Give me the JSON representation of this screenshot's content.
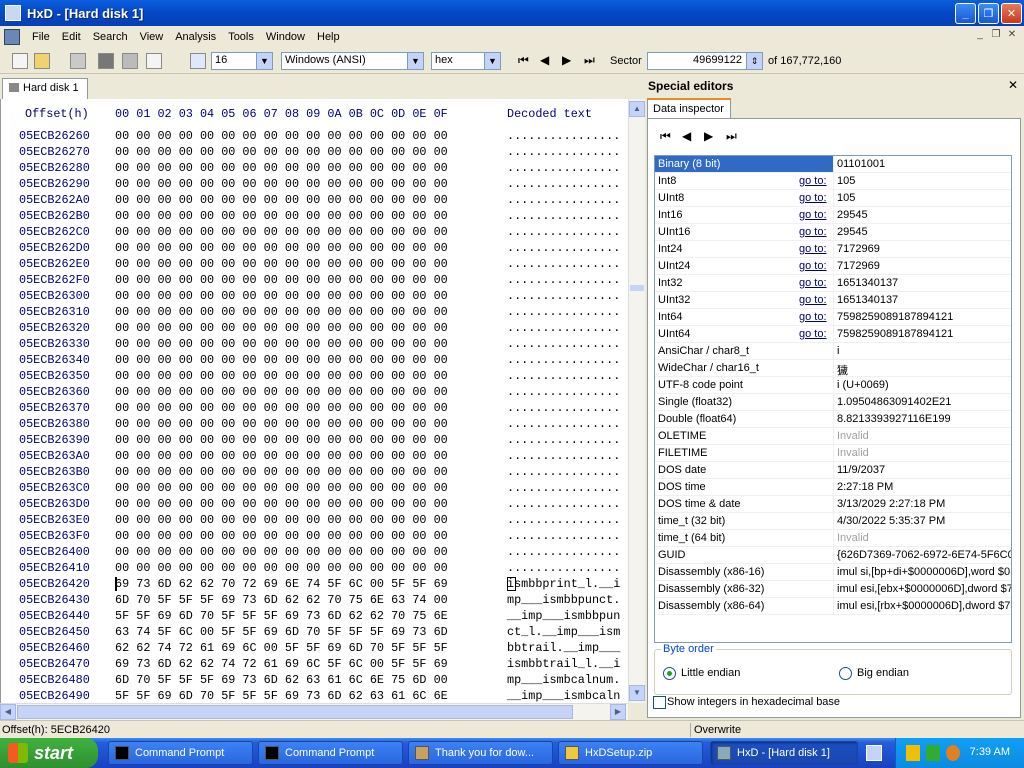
{
  "window": {
    "title": "HxD - [Hard disk 1]"
  },
  "menu": [
    "File",
    "Edit",
    "Search",
    "View",
    "Analysis",
    "Tools",
    "Window",
    "Help"
  ],
  "toolbar": {
    "bytes_per_row": "16",
    "charset": "Windows (ANSI)",
    "offset_base": "hex",
    "sector_label": "Sector",
    "sector_value": "49699122",
    "sector_total": "of 167,772,160"
  },
  "tab": {
    "label": "Hard disk 1"
  },
  "hex": {
    "header_offset": "Offset(h)",
    "header_cols": "00 01 02 03 04 05 06 07 08 09 0A 0B 0C 0D 0E 0F",
    "header_text": "Decoded text",
    "rows": [
      {
        "o": "05ECB26260",
        "h": "00 00 00 00 00 00 00 00 00 00 00 00 00 00 00 00",
        "t": "................"
      },
      {
        "o": "05ECB26270",
        "h": "00 00 00 00 00 00 00 00 00 00 00 00 00 00 00 00",
        "t": "................"
      },
      {
        "o": "05ECB26280",
        "h": "00 00 00 00 00 00 00 00 00 00 00 00 00 00 00 00",
        "t": "................"
      },
      {
        "o": "05ECB26290",
        "h": "00 00 00 00 00 00 00 00 00 00 00 00 00 00 00 00",
        "t": "................"
      },
      {
        "o": "05ECB262A0",
        "h": "00 00 00 00 00 00 00 00 00 00 00 00 00 00 00 00",
        "t": "................"
      },
      {
        "o": "05ECB262B0",
        "h": "00 00 00 00 00 00 00 00 00 00 00 00 00 00 00 00",
        "t": "................"
      },
      {
        "o": "05ECB262C0",
        "h": "00 00 00 00 00 00 00 00 00 00 00 00 00 00 00 00",
        "t": "................"
      },
      {
        "o": "05ECB262D0",
        "h": "00 00 00 00 00 00 00 00 00 00 00 00 00 00 00 00",
        "t": "................"
      },
      {
        "o": "05ECB262E0",
        "h": "00 00 00 00 00 00 00 00 00 00 00 00 00 00 00 00",
        "t": "................"
      },
      {
        "o": "05ECB262F0",
        "h": "00 00 00 00 00 00 00 00 00 00 00 00 00 00 00 00",
        "t": "................"
      },
      {
        "o": "05ECB26300",
        "h": "00 00 00 00 00 00 00 00 00 00 00 00 00 00 00 00",
        "t": "................"
      },
      {
        "o": "05ECB26310",
        "h": "00 00 00 00 00 00 00 00 00 00 00 00 00 00 00 00",
        "t": "................"
      },
      {
        "o": "05ECB26320",
        "h": "00 00 00 00 00 00 00 00 00 00 00 00 00 00 00 00",
        "t": "................"
      },
      {
        "o": "05ECB26330",
        "h": "00 00 00 00 00 00 00 00 00 00 00 00 00 00 00 00",
        "t": "................"
      },
      {
        "o": "05ECB26340",
        "h": "00 00 00 00 00 00 00 00 00 00 00 00 00 00 00 00",
        "t": "................"
      },
      {
        "o": "05ECB26350",
        "h": "00 00 00 00 00 00 00 00 00 00 00 00 00 00 00 00",
        "t": "................"
      },
      {
        "o": "05ECB26360",
        "h": "00 00 00 00 00 00 00 00 00 00 00 00 00 00 00 00",
        "t": "................"
      },
      {
        "o": "05ECB26370",
        "h": "00 00 00 00 00 00 00 00 00 00 00 00 00 00 00 00",
        "t": "................"
      },
      {
        "o": "05ECB26380",
        "h": "00 00 00 00 00 00 00 00 00 00 00 00 00 00 00 00",
        "t": "................"
      },
      {
        "o": "05ECB26390",
        "h": "00 00 00 00 00 00 00 00 00 00 00 00 00 00 00 00",
        "t": "................"
      },
      {
        "o": "05ECB263A0",
        "h": "00 00 00 00 00 00 00 00 00 00 00 00 00 00 00 00",
        "t": "................"
      },
      {
        "o": "05ECB263B0",
        "h": "00 00 00 00 00 00 00 00 00 00 00 00 00 00 00 00",
        "t": "................"
      },
      {
        "o": "05ECB263C0",
        "h": "00 00 00 00 00 00 00 00 00 00 00 00 00 00 00 00",
        "t": "................"
      },
      {
        "o": "05ECB263D0",
        "h": "00 00 00 00 00 00 00 00 00 00 00 00 00 00 00 00",
        "t": "................"
      },
      {
        "o": "05ECB263E0",
        "h": "00 00 00 00 00 00 00 00 00 00 00 00 00 00 00 00",
        "t": "................"
      },
      {
        "o": "05ECB263F0",
        "h": "00 00 00 00 00 00 00 00 00 00 00 00 00 00 00 00",
        "t": "................"
      },
      {
        "o": "05ECB26400",
        "h": "00 00 00 00 00 00 00 00 00 00 00 00 00 00 00 00",
        "t": "................"
      },
      {
        "o": "05ECB26410",
        "h": "00 00 00 00 00 00 00 00 00 00 00 00 00 00 00 00",
        "t": "................"
      },
      {
        "o": "05ECB26420",
        "h": "69 73 6D 62 62 70 72 69 6E 74 5F 6C 00 5F 5F 69",
        "t": "ismbbprint_l.__i"
      },
      {
        "o": "05ECB26430",
        "h": "6D 70 5F 5F 5F 69 73 6D 62 62 70 75 6E 63 74 00",
        "t": "mp___ismbbpunct."
      },
      {
        "o": "05ECB26440",
        "h": "5F 5F 69 6D 70 5F 5F 5F 69 73 6D 62 62 70 75 6E",
        "t": "__imp___ismbbpun"
      },
      {
        "o": "05ECB26450",
        "h": "63 74 5F 6C 00 5F 5F 69 6D 70 5F 5F 5F 69 73 6D",
        "t": "ct_l.__imp___ism"
      },
      {
        "o": "05ECB26460",
        "h": "62 62 74 72 61 69 6C 00 5F 5F 69 6D 70 5F 5F 5F",
        "t": "bbtrail.__imp___"
      },
      {
        "o": "05ECB26470",
        "h": "69 73 6D 62 62 74 72 61 69 6C 5F 6C 00 5F 5F 69",
        "t": "ismbbtrail_l.__i"
      },
      {
        "o": "05ECB26480",
        "h": "6D 70 5F 5F 5F 69 73 6D 62 63 61 6C 6E 75 6D 00",
        "t": "mp___ismbcalnum."
      },
      {
        "o": "05ECB26490",
        "h": "5F 5F 69 6D 70 5F 5F 5F 69 73 6D 62 63 61 6C 6E",
        "t": "__imp___ismbcaln"
      }
    ]
  },
  "special_editors": {
    "title": "Special editors",
    "tab": "Data inspector",
    "goto_label": "go to:",
    "rows": [
      {
        "name": "Binary (8 bit)",
        "goto": false,
        "value": "01101001",
        "selected": true
      },
      {
        "name": "Int8",
        "goto": true,
        "value": "105"
      },
      {
        "name": "UInt8",
        "goto": true,
        "value": "105"
      },
      {
        "name": "Int16",
        "goto": true,
        "value": "29545"
      },
      {
        "name": "UInt16",
        "goto": true,
        "value": "29545"
      },
      {
        "name": "Int24",
        "goto": true,
        "value": "7172969"
      },
      {
        "name": "UInt24",
        "goto": true,
        "value": "7172969"
      },
      {
        "name": "Int32",
        "goto": true,
        "value": "1651340137"
      },
      {
        "name": "UInt32",
        "goto": true,
        "value": "1651340137"
      },
      {
        "name": "Int64",
        "goto": true,
        "value": "7598259089187894121"
      },
      {
        "name": "UInt64",
        "goto": true,
        "value": "7598259089187894121"
      },
      {
        "name": "AnsiChar / char8_t",
        "goto": false,
        "value": "i"
      },
      {
        "name": "WideChar / char16_t",
        "goto": false,
        "value": "獩"
      },
      {
        "name": "UTF-8 code point",
        "goto": false,
        "value": "i (U+0069)"
      },
      {
        "name": "Single (float32)",
        "goto": false,
        "value": "1.09504863091402E21"
      },
      {
        "name": "Double (float64)",
        "goto": false,
        "value": "8.8213393927116E199"
      },
      {
        "name": "OLETIME",
        "goto": false,
        "value": "Invalid",
        "invalid": true
      },
      {
        "name": "FILETIME",
        "goto": false,
        "value": "Invalid",
        "invalid": true
      },
      {
        "name": "DOS date",
        "goto": false,
        "value": "11/9/2037"
      },
      {
        "name": "DOS time",
        "goto": false,
        "value": "2:27:18 PM"
      },
      {
        "name": "DOS time & date",
        "goto": false,
        "value": "3/13/2029 2:27:18 PM"
      },
      {
        "name": "time_t (32 bit)",
        "goto": false,
        "value": "4/30/2022 5:35:37 PM"
      },
      {
        "name": "time_t (64 bit)",
        "goto": false,
        "value": "Invalid",
        "invalid": true
      },
      {
        "name": "GUID",
        "goto": false,
        "value": "{626D7369-7062-6972-6E74-5F6C0"
      },
      {
        "name": "Disassembly (x86-16)",
        "goto": false,
        "value": "imul si,[bp+di+$0000006D],word $0"
      },
      {
        "name": "Disassembly (x86-32)",
        "goto": false,
        "value": "imul esi,[ebx+$0000006D],dword $7"
      },
      {
        "name": "Disassembly (x86-64)",
        "goto": false,
        "value": "imul esi,[rbx+$0000006D],dword $7"
      }
    ],
    "byte_order_label": "Byte order",
    "little_endian": "Little endian",
    "big_endian": "Big endian",
    "hex_checkbox": "Show integers in hexadecimal base"
  },
  "status": {
    "offset": "Offset(h): 5ECB26420",
    "mode": "Overwrite"
  },
  "taskbar": {
    "start": "start",
    "tasks": [
      "Command Prompt",
      "Command Prompt",
      "Thank you for dow...",
      "HxDSetup.zip",
      "HxD - [Hard disk 1]"
    ],
    "clock": "7:39 AM"
  }
}
